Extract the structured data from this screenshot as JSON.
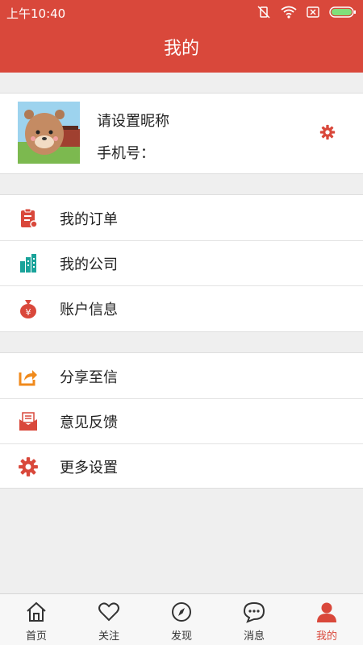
{
  "status_bar": {
    "time": "上午10:40"
  },
  "header": {
    "title": "我的"
  },
  "profile": {
    "nickname": "请设置昵称",
    "phone_label": "手机号："
  },
  "menu_group_1": [
    {
      "label": "我的订单",
      "icon": "order-clipboard-icon",
      "color": "#d9483b"
    },
    {
      "label": "我的公司",
      "icon": "company-building-icon",
      "color": "#1aa39a"
    },
    {
      "label": "账户信息",
      "icon": "money-bag-icon",
      "color": "#d9483b"
    }
  ],
  "menu_group_2": [
    {
      "label": "分享至信",
      "icon": "share-icon",
      "color": "#f08a1c"
    },
    {
      "label": "意见反馈",
      "icon": "feedback-mail-icon",
      "color": "#d9483b"
    },
    {
      "label": "更多设置",
      "icon": "gear-icon",
      "color": "#d9483b"
    }
  ],
  "tabs": [
    {
      "label": "首页",
      "icon": "home-icon"
    },
    {
      "label": "关注",
      "icon": "heart-icon"
    },
    {
      "label": "发现",
      "icon": "compass-icon"
    },
    {
      "label": "消息",
      "icon": "message-icon"
    },
    {
      "label": "我的",
      "icon": "person-icon",
      "active": true
    }
  ],
  "colors": {
    "accent": "#d9483b",
    "teal": "#1aa39a",
    "orange": "#f08a1c",
    "background": "#efefef"
  }
}
